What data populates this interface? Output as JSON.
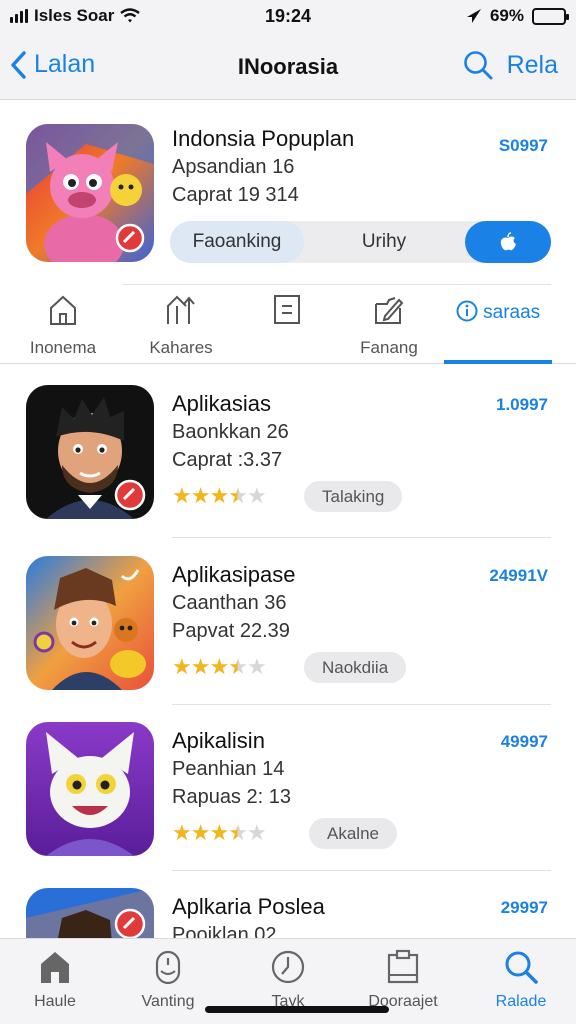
{
  "status_bar": {
    "carrier": "Isles Soar",
    "time": "19:24",
    "battery_percent": "69%",
    "battery_level": 0.69
  },
  "nav": {
    "back_label": "Lalan",
    "title": "INoorasia",
    "right_label": "Rela"
  },
  "featured": {
    "name": "Indonsia Popuplan",
    "subtitle": "Apsandian 16",
    "detail": "Caprat 19 314",
    "number": "S0997",
    "segments": [
      "Faoanking",
      "Urihy"
    ]
  },
  "category_tabs": [
    {
      "label": "Inonema",
      "icon": "home-icon"
    },
    {
      "label": "Kahares",
      "icon": "arrows-icon"
    },
    {
      "label": "",
      "icon": "document-icon"
    },
    {
      "label": "Fanang",
      "icon": "edit-icon"
    }
  ],
  "active_tab": "saraas",
  "apps": [
    {
      "name": "Aplikasias",
      "subtitle": "Baonkkan 26",
      "detail": "Caprat :3.37",
      "number": "1.0997",
      "rating": 3.5,
      "button": "Talaking"
    },
    {
      "name": "Aplikasipase",
      "subtitle": "Caanthan 36",
      "detail": "Papvat 22.39",
      "number": "24991V",
      "rating": 3.5,
      "button": "Naokdiia"
    },
    {
      "name": "Apikalisin",
      "subtitle": "Peanhian 14",
      "detail": "Rapuas 2: 13",
      "number": "49997",
      "rating": 3.5,
      "button": "Akalne"
    },
    {
      "name": "Aplkaria Poslea",
      "subtitle": "Pooiklan 02",
      "detail": "",
      "number": "29997",
      "rating": null,
      "button": ""
    }
  ],
  "tab_bar": [
    {
      "label": "Haule",
      "icon": "home-icon"
    },
    {
      "label": "Vanting",
      "icon": "mouse-icon"
    },
    {
      "label": "Tayk",
      "icon": "clock-icon"
    },
    {
      "label": "Dooraajet",
      "icon": "clipboard-icon"
    },
    {
      "label": "Ralade",
      "icon": "search-icon"
    }
  ],
  "colors": {
    "accent": "#1a82e6",
    "star": "#f2b51c",
    "bar_background": "#f3f3f5"
  }
}
